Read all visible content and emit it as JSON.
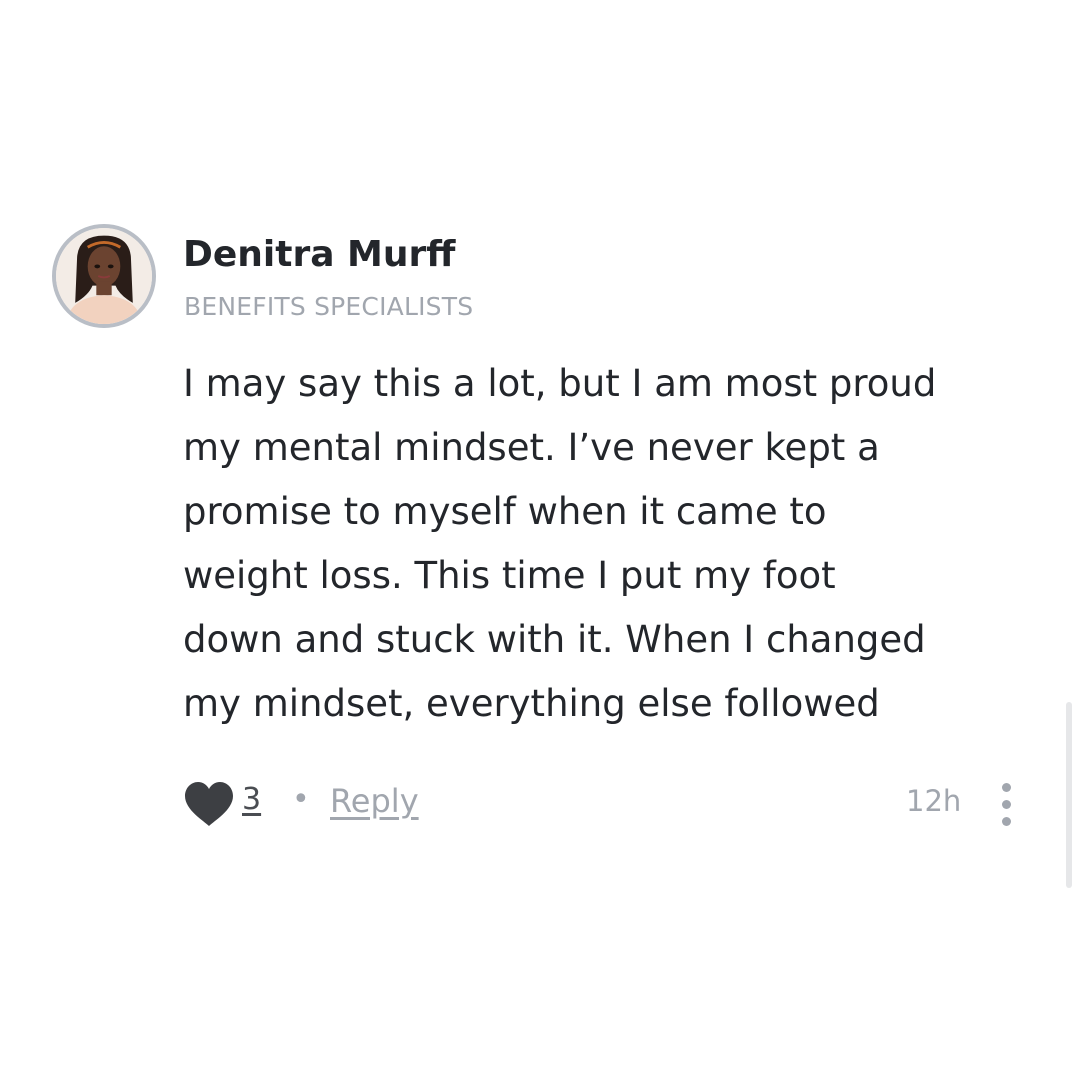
{
  "comment": {
    "author": {
      "name": "Denitra Murff",
      "role": "BENEFITS SPECIALISTS",
      "avatar_icon": "profile-photo"
    },
    "body_lines": [
      "I may say this a lot, but I am most proud",
      "my mental mindset. I’ve never kept a",
      "promise to myself when it came to",
      "weight loss. This time I put my foot",
      "down and stuck with it. When I changed",
      "my mindset, everything else followed"
    ],
    "actions": {
      "like_icon": "heart-icon",
      "like_count": "3",
      "separator": "•",
      "reply_label": "Reply",
      "timestamp": "12h",
      "more_icon": "vertical-ellipsis-icon"
    }
  },
  "colors": {
    "text_primary": "#23262b",
    "text_muted": "#a1a6ae",
    "heart": "#3d3f43",
    "avatar_ring": "#b9bec6"
  }
}
